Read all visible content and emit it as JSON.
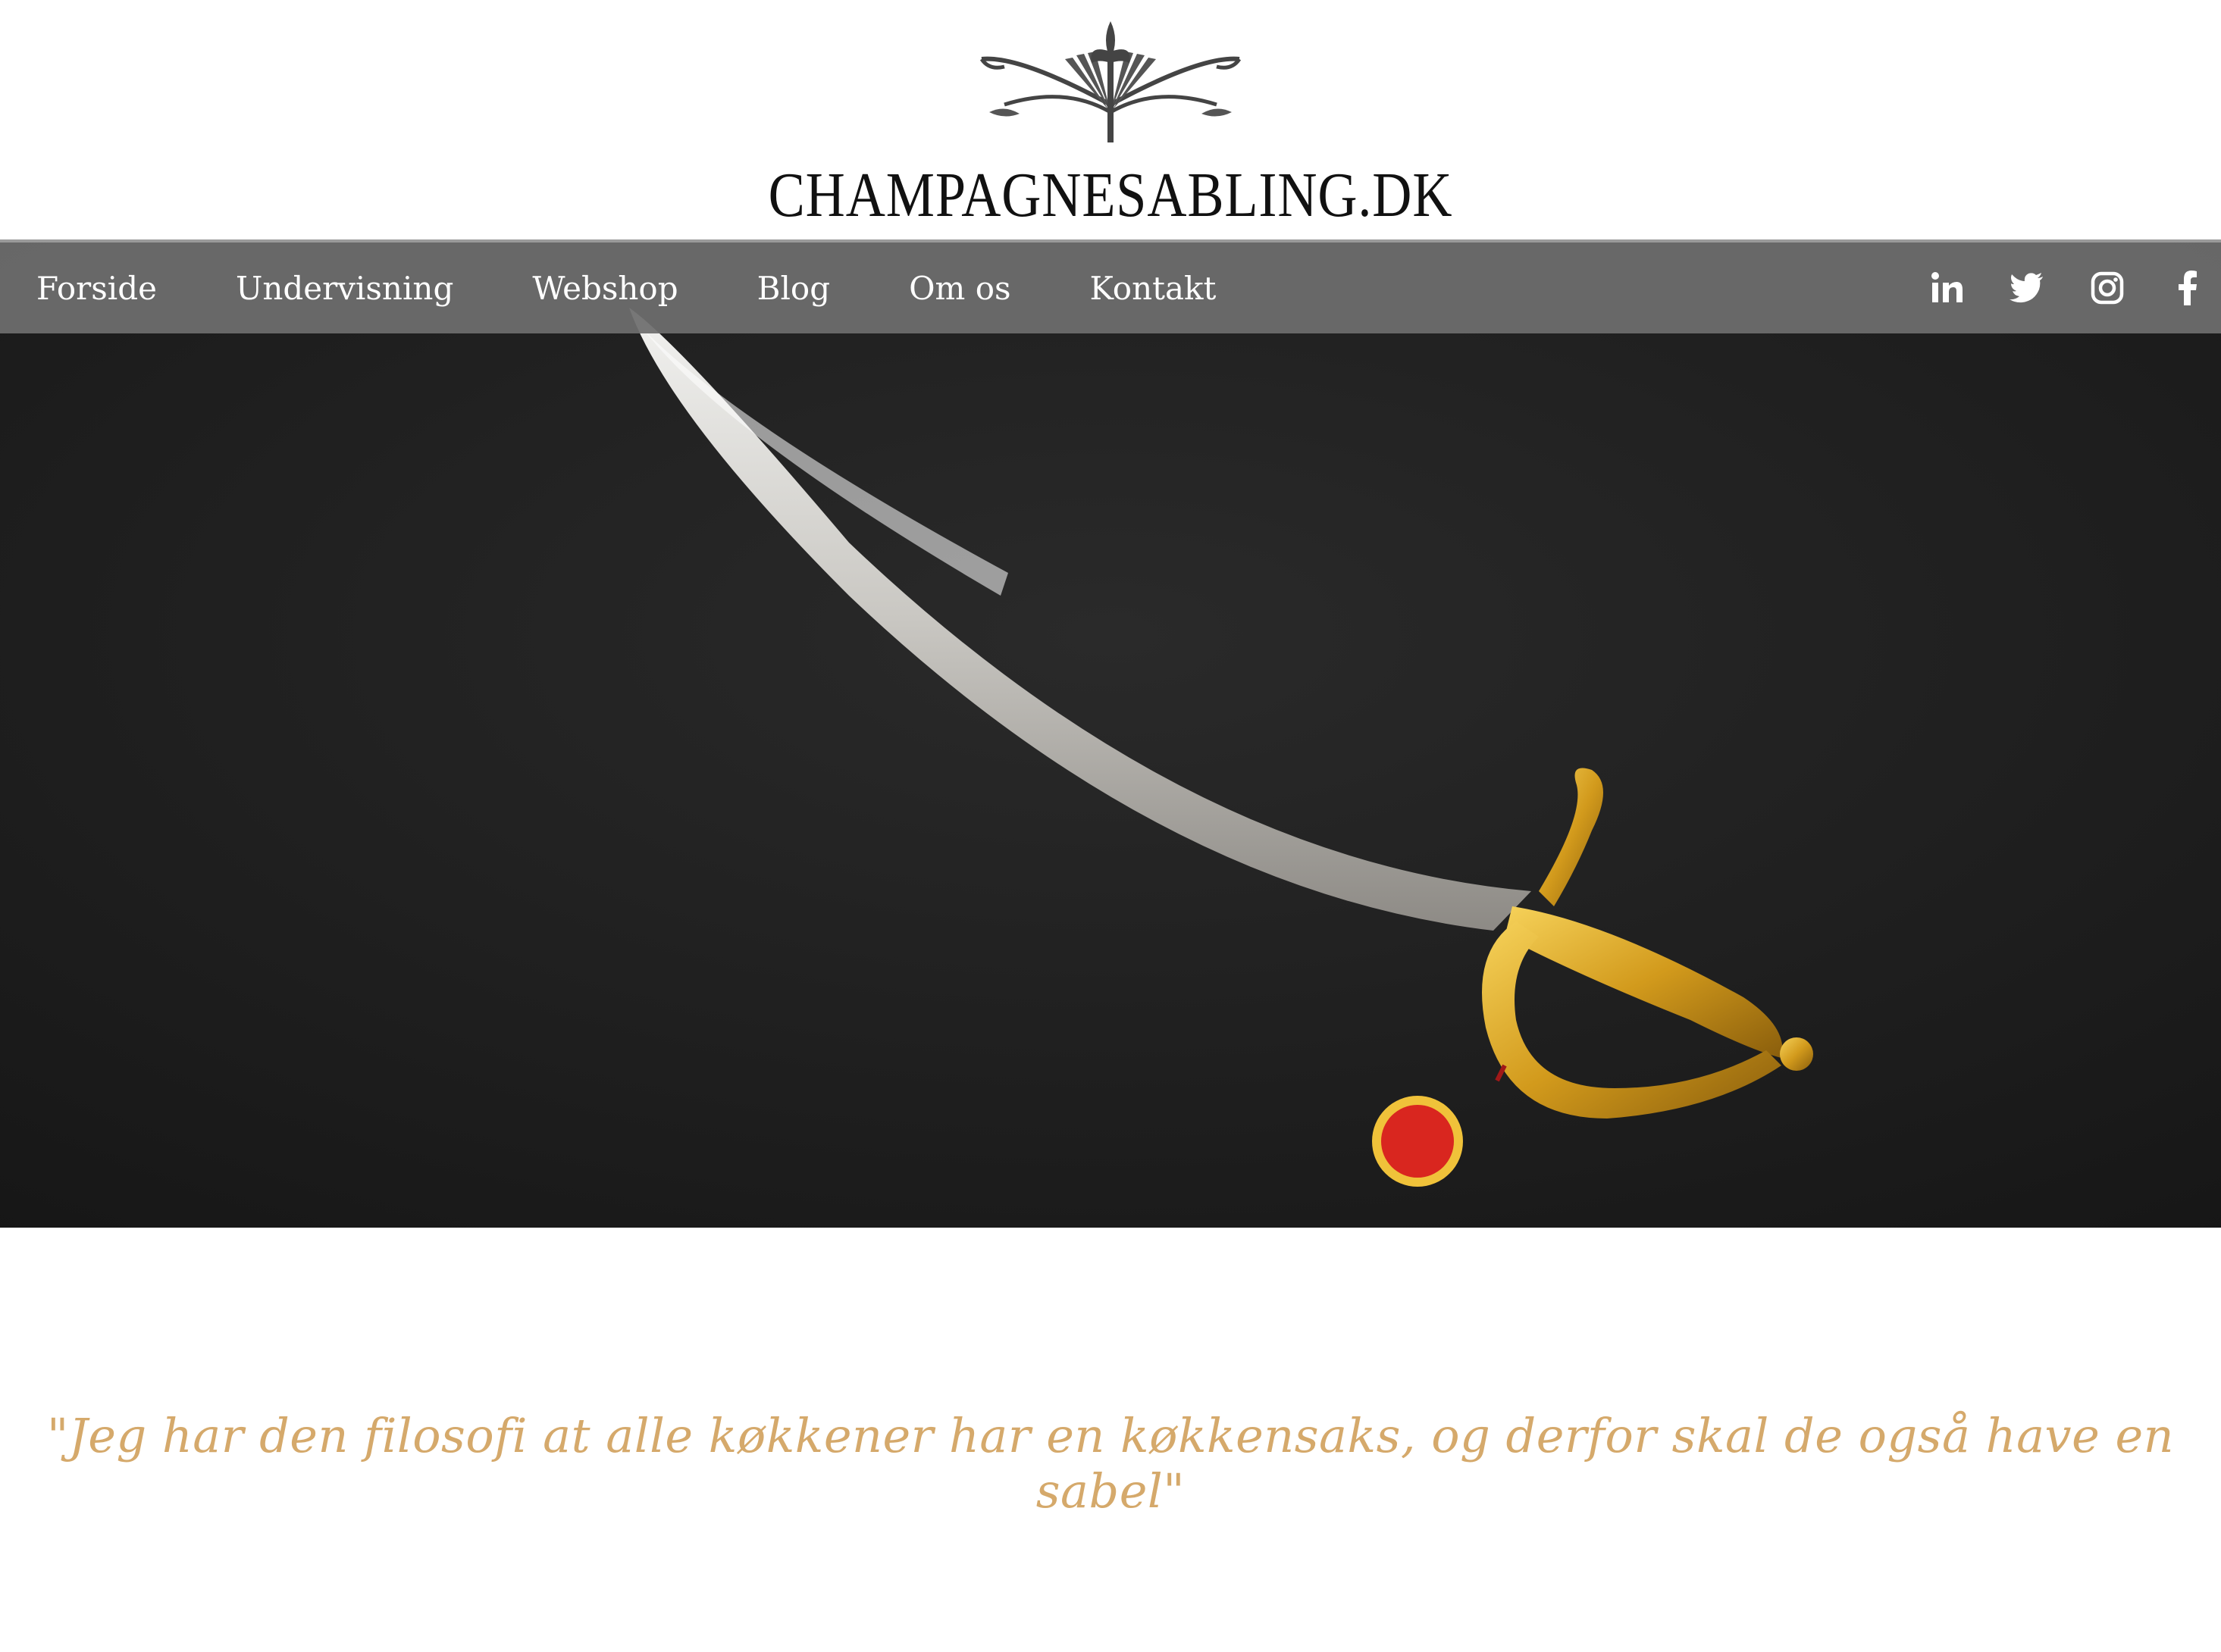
{
  "brand": {
    "name": "CHAMPAGNESABLING.DK",
    "logo_icon": "crossed-sabres-fleur-de-lis-emblem"
  },
  "nav": {
    "items": [
      {
        "label": "Forside"
      },
      {
        "label": "Undervisning"
      },
      {
        "label": "Webshop"
      },
      {
        "label": "Blog"
      },
      {
        "label": "Om os"
      },
      {
        "label": "Kontakt"
      }
    ]
  },
  "social": [
    {
      "icon": "linkedin-icon",
      "label": "in"
    },
    {
      "icon": "twitter-icon"
    },
    {
      "icon": "instagram-icon"
    },
    {
      "icon": "facebook-icon",
      "label": "f"
    }
  ],
  "hero": {
    "image": "gold-hilted-champagne-sabre-on-black-background"
  },
  "quote": {
    "text": "\"Jeg har den filosofi at alle køkkener har en køkkensaks, og derfor skal de også have en sabel\""
  },
  "colors": {
    "nav_background": "#6e6e6e",
    "quote_gold": "#d5a96b",
    "hero_background": "#1e1e1e"
  }
}
